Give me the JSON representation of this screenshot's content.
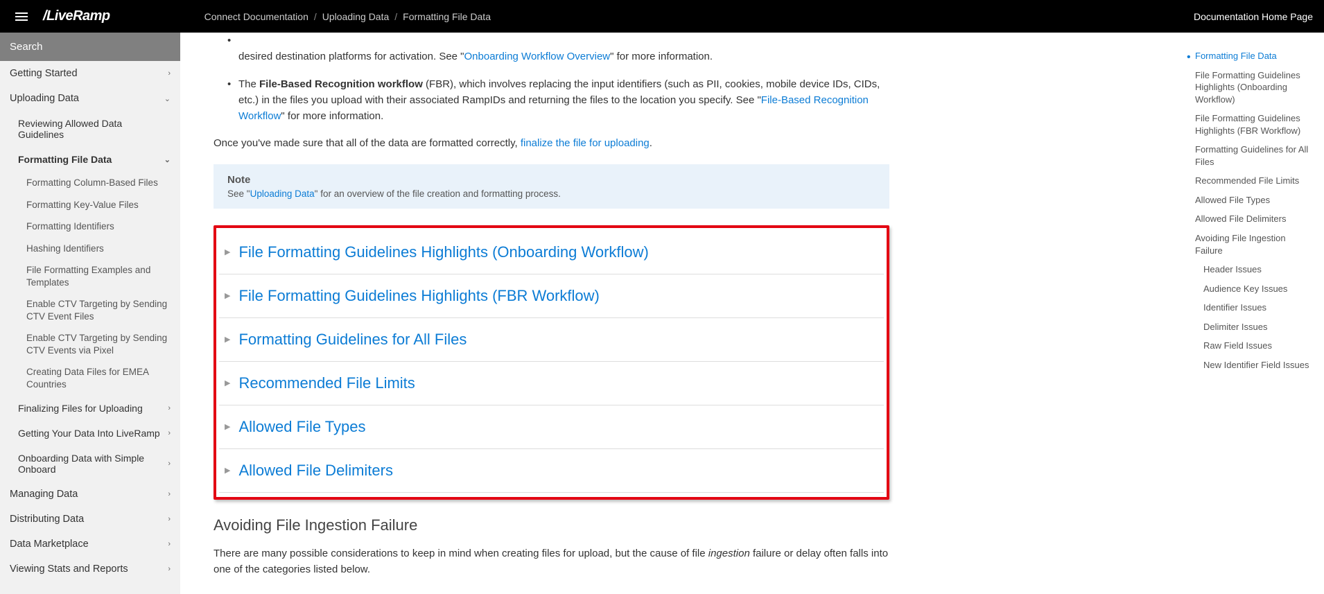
{
  "header": {
    "logo": "/LiveRamp",
    "breadcrumbs": [
      "Connect Documentation",
      "Uploading Data",
      "Formatting File Data"
    ],
    "home_link": "Documentation Home Page"
  },
  "sidebar": {
    "search_placeholder": "Search",
    "items": [
      {
        "label": "Getting Started",
        "level": 0,
        "chev": "›"
      },
      {
        "label": "Uploading Data",
        "level": 0,
        "chev": "⌄"
      },
      {
        "label": "Reviewing Allowed Data Guidelines",
        "level": 1
      },
      {
        "label": "Formatting File Data",
        "level": 1,
        "active": true,
        "chev": "⌄"
      },
      {
        "label": "Formatting Column-Based Files",
        "level": 2
      },
      {
        "label": "Formatting Key-Value Files",
        "level": 2
      },
      {
        "label": "Formatting Identifiers",
        "level": 2
      },
      {
        "label": "Hashing Identifiers",
        "level": 2
      },
      {
        "label": "File Formatting Examples and Templates",
        "level": 2
      },
      {
        "label": "Enable CTV Targeting by Sending CTV Event Files",
        "level": 2
      },
      {
        "label": "Enable CTV Targeting by Sending CTV Events via Pixel",
        "level": 2
      },
      {
        "label": "Creating Data Files for EMEA Countries",
        "level": 2
      },
      {
        "label": "Finalizing Files for Uploading",
        "level": 1,
        "chev": "›"
      },
      {
        "label": "Getting Your Data Into LiveRamp",
        "level": 1,
        "chev": "›"
      },
      {
        "label": "Onboarding Data with Simple Onboard",
        "level": 1,
        "chev": "›"
      },
      {
        "label": "Managing Data",
        "level": 0,
        "chev": "›"
      },
      {
        "label": "Distributing Data",
        "level": 0,
        "chev": "›"
      },
      {
        "label": "Data Marketplace",
        "level": 0,
        "chev": "›"
      },
      {
        "label": "Viewing Stats and Reports",
        "level": 0,
        "chev": "›"
      }
    ]
  },
  "content": {
    "top_truncated": "Onboarding Workflow Overview",
    "top_suffix": "\" for more information.",
    "top_line_prefix": "desired destination platforms for activation. See \"",
    "bullet_prefix": "The ",
    "bullet_bold": "File-Based Recognition workflow",
    "bullet_rest": " (FBR), which involves replacing the input identifiers (such as PII, cookies, mobile device IDs, CIDs, etc.) in the files you upload with their associated RampIDs and returning the files to the location you specify. See \"",
    "bullet_link": "File-Based Recognition Workflow",
    "bullet_suffix": "\" for more information.",
    "finalize_prefix": "Once you've made sure that all of the data are formatted correctly, ",
    "finalize_link": "finalize the file for uploading",
    "finalize_suffix": ".",
    "note_title": "Note",
    "note_prefix": "See \"",
    "note_link": "Uploading Data",
    "note_suffix": "\" for an overview of the file creation and formatting process.",
    "expanders": [
      "File Formatting Guidelines Highlights (Onboarding Workflow)",
      "File Formatting Guidelines Highlights (FBR Workflow)",
      "Formatting Guidelines for All Files",
      "Recommended File Limits",
      "Allowed File Types",
      "Allowed File Delimiters"
    ],
    "section_heading": "Avoiding File Ingestion Failure",
    "section_text_1": "There are many possible considerations to keep in mind when creating files for upload, but the cause of file ",
    "section_italic": "ingestion",
    "section_text_2": " failure or delay often falls into one of the categories listed below."
  },
  "toc": {
    "items": [
      {
        "label": "Formatting File Data",
        "active": true
      },
      {
        "label": "File Formatting Guidelines Highlights (Onboarding Workflow)"
      },
      {
        "label": "File Formatting Guidelines Highlights (FBR Workflow)"
      },
      {
        "label": "Formatting Guidelines for All Files"
      },
      {
        "label": "Recommended File Limits"
      },
      {
        "label": "Allowed File Types"
      },
      {
        "label": "Allowed File Delimiters"
      },
      {
        "label": "Avoiding File Ingestion Failure"
      },
      {
        "label": "Header Issues",
        "sub": true
      },
      {
        "label": "Audience Key Issues",
        "sub": true
      },
      {
        "label": "Identifier Issues",
        "sub": true
      },
      {
        "label": "Delimiter Issues",
        "sub": true
      },
      {
        "label": "Raw Field Issues",
        "sub": true
      },
      {
        "label": "New Identifier Field Issues",
        "sub": true
      }
    ]
  }
}
